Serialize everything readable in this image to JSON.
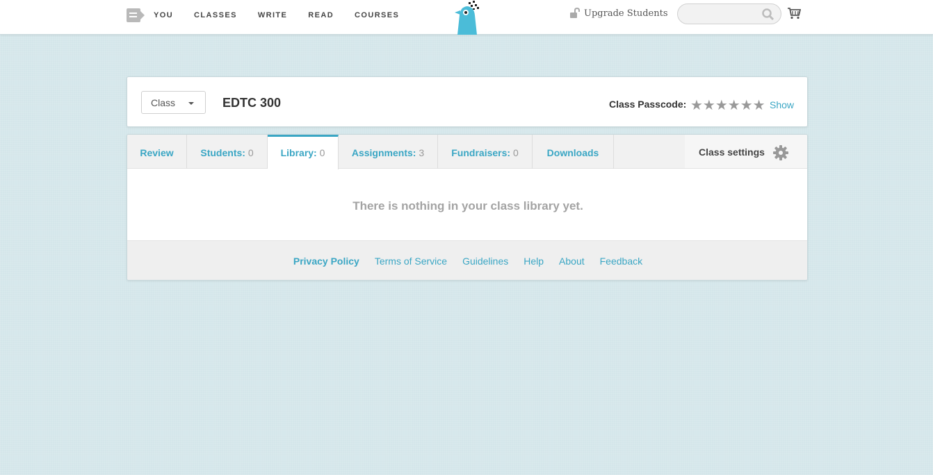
{
  "nav": {
    "links": [
      "YOU",
      "CLASSES",
      "WRITE",
      "READ",
      "COURSES"
    ],
    "upgrade_label": "Upgrade Students",
    "search_placeholder": ""
  },
  "class_header": {
    "selector_label": "Class",
    "class_name": "EDTC 300",
    "passcode_label": "Class Passcode:",
    "passcode_masked": "★★★★★★",
    "show_label": "Show"
  },
  "tabs": [
    {
      "label": "Review",
      "count": ""
    },
    {
      "label": "Students:",
      "count": "0"
    },
    {
      "label": "Library:",
      "count": "0"
    },
    {
      "label": "Assignments:",
      "count": "3"
    },
    {
      "label": "Fundraisers:",
      "count": "0"
    },
    {
      "label": "Downloads",
      "count": ""
    }
  ],
  "active_tab": "Library:",
  "settings_label": "Class settings",
  "empty_message": "There is nothing in your class library yet.",
  "footer_links": [
    "Privacy Policy",
    "Terms of Service",
    "Guidelines",
    "Help",
    "About",
    "Feedback"
  ],
  "colors": {
    "accent": "#3aa6c4",
    "background": "#d4e6ea",
    "logo": "#4bbcd8"
  },
  "icons": [
    "menu-icon",
    "bird-logo-icon",
    "lock-icon",
    "search-icon",
    "cart-icon",
    "gear-icon",
    "caret-down-icon"
  ]
}
